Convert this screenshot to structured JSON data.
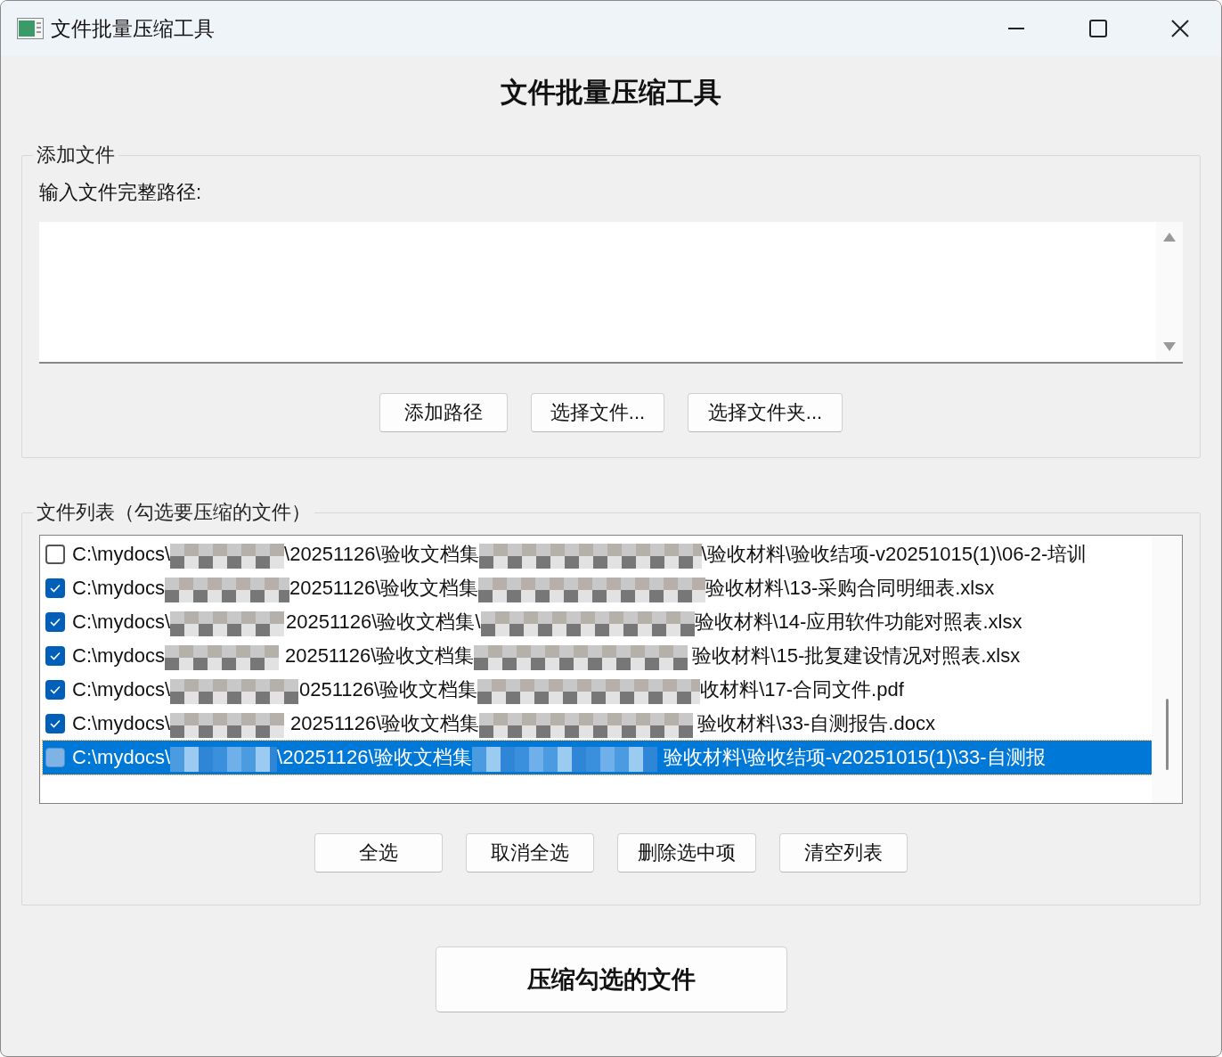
{
  "window": {
    "title": "文件批量压缩工具"
  },
  "heading": "文件批量压缩工具",
  "add_group": {
    "legend": "添加文件",
    "label": "输入文件完整路径:",
    "buttons": [
      "添加路径",
      "选择文件...",
      "选择文件夹..."
    ]
  },
  "list_group": {
    "legend": "文件列表（勾选要压缩的文件）",
    "rows": [
      {
        "parts": [
          "C:\\mydocs\\",
          "\\20251126\\验收文档集",
          "\\验收材料\\验收结项-v20251015(1)\\06-2-培训"
        ],
        "checked": false,
        "selected": false
      },
      {
        "parts": [
          "C:\\mydocs",
          "20251126\\验收文档集",
          "验收材料\\13-采购合同明细表.xlsx"
        ],
        "checked": true,
        "selected": false
      },
      {
        "parts": [
          "C:\\mydocs\\",
          "20251126\\验收文档集\\",
          "验收材料\\14-应用软件功能对照表.xlsx"
        ],
        "checked": true,
        "selected": false
      },
      {
        "parts": [
          "C:\\mydocs",
          "20251126\\验收文档集",
          "验收材料\\15-批复建设情况对照表.xlsx"
        ],
        "checked": true,
        "selected": false
      },
      {
        "parts": [
          "C:\\mydocs\\",
          "0251126\\验收文档集",
          "收材料\\17-合同文件.pdf"
        ],
        "checked": true,
        "selected": false
      },
      {
        "parts": [
          "C:\\mydocs\\",
          "20251126\\验收文档集",
          "验收材料\\33-自测报告.docx"
        ],
        "checked": true,
        "selected": false
      },
      {
        "parts": [
          "C:\\mydocs\\",
          "\\20251126\\验收文档集",
          "验收材料\\验收结项-v20251015(1)\\33-自测报"
        ],
        "checked": false,
        "selected": true
      }
    ],
    "buttons": [
      "全选",
      "取消全选",
      "删除选中项",
      "清空列表"
    ]
  },
  "compress_button": "压缩勾选的文件"
}
